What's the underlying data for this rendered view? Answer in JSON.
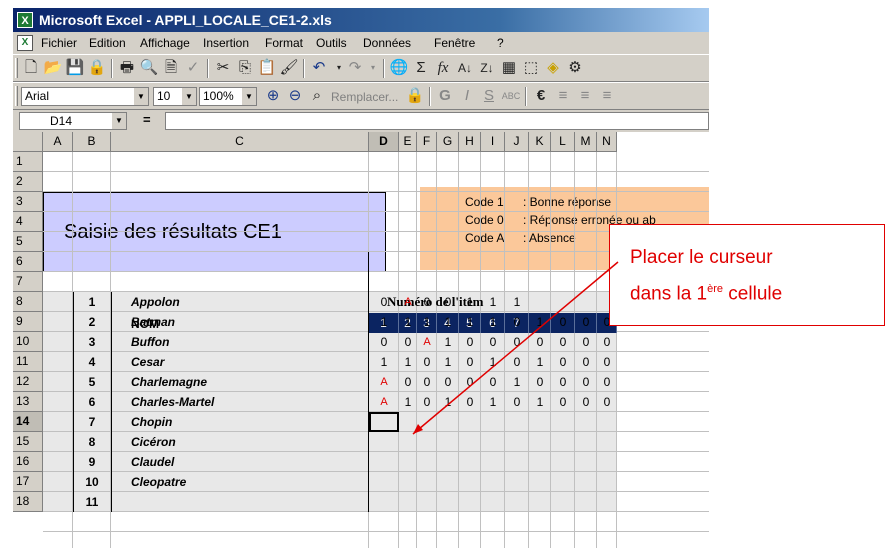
{
  "window": {
    "title": "Microsoft Excel - APPLI_LOCALE_CE1-2.xls"
  },
  "menu": [
    "Fichier",
    "Edition",
    "Affichage",
    "Insertion",
    "Format",
    "Outils",
    "Données",
    "Fenêtre",
    "?"
  ],
  "format_toolbar": {
    "font": "Arial",
    "size": "10",
    "zoom": "100%",
    "replace_label": "Remplacer..."
  },
  "formula_bar": {
    "cell_ref": "D14",
    "equals": "="
  },
  "columns": [
    "A",
    "B",
    "C",
    "D",
    "E",
    "F",
    "G",
    "H",
    "I",
    "J",
    "K",
    "L",
    "M",
    "N"
  ],
  "rows": [
    "1",
    "2",
    "3",
    "4",
    "5",
    "6",
    "7",
    "8",
    "9",
    "10",
    "11",
    "12",
    "13",
    "14",
    "15",
    "16",
    "17",
    "18"
  ],
  "sheet": {
    "title": "Saisie des résultats CE1",
    "legend": [
      {
        "code": "Code   1",
        "desc": ": Bonne réponse"
      },
      {
        "code": "Code   0",
        "desc": ": Réponse erronée ou ab"
      },
      {
        "code": "Code   A",
        "desc": ": Absence"
      }
    ],
    "item_header": "Numéro de l'item",
    "nom_header": "NOM",
    "item_numbers": [
      "1",
      "2",
      "3",
      "4",
      "5",
      "6",
      "7",
      "",
      "",
      "",
      ""
    ],
    "students": [
      {
        "n": "1",
        "name": "Appolon",
        "scores": [
          "0",
          "A",
          "0",
          "0",
          "1",
          "1",
          "1",
          "",
          "",
          "",
          ""
        ]
      },
      {
        "n": "2",
        "name": "Batman",
        "scores": [
          "1",
          "1",
          "1",
          "1",
          "1",
          "1",
          "0",
          "1",
          "0",
          "0",
          "0"
        ]
      },
      {
        "n": "3",
        "name": "Buffon",
        "scores": [
          "0",
          "0",
          "A",
          "1",
          "0",
          "0",
          "0",
          "0",
          "0",
          "0",
          "0"
        ]
      },
      {
        "n": "4",
        "name": "Cesar",
        "scores": [
          "1",
          "1",
          "0",
          "1",
          "0",
          "1",
          "0",
          "1",
          "0",
          "0",
          "0"
        ]
      },
      {
        "n": "5",
        "name": "Charlemagne",
        "scores": [
          "A",
          "0",
          "0",
          "0",
          "0",
          "0",
          "1",
          "0",
          "0",
          "0",
          "0"
        ]
      },
      {
        "n": "6",
        "name": "Charles-Martel",
        "scores": [
          "A",
          "1",
          "0",
          "1",
          "0",
          "1",
          "0",
          "1",
          "0",
          "0",
          "0"
        ]
      },
      {
        "n": "7",
        "name": "Chopin",
        "scores": [
          "",
          "",
          "",
          "",
          "",
          "",
          "",
          "",
          "",
          "",
          ""
        ]
      },
      {
        "n": "8",
        "name": "Cicéron",
        "scores": [
          "",
          "",
          "",
          "",
          "",
          "",
          "",
          "",
          "",
          "",
          ""
        ]
      },
      {
        "n": "9",
        "name": "Claudel",
        "scores": [
          "",
          "",
          "",
          "",
          "",
          "",
          "",
          "",
          "",
          "",
          ""
        ]
      },
      {
        "n": "10",
        "name": "Cleopatre",
        "scores": [
          "",
          "",
          "",
          "",
          "",
          "",
          "",
          "",
          "",
          "",
          ""
        ]
      },
      {
        "n": "11",
        "name": "",
        "scores": [
          "",
          "",
          "",
          "",
          "",
          "",
          "",
          "",
          "",
          "",
          ""
        ]
      }
    ]
  },
  "callout": {
    "line1": "Placer le curseur",
    "line2_pre": "dans la 1",
    "line2_sup": "ère",
    "line2_post": " cellule"
  },
  "colors": {
    "title_fill": "#ccccff",
    "legend_fill": "#fbc89a",
    "header_fill": "#0b2461",
    "callout": "#e00000"
  }
}
